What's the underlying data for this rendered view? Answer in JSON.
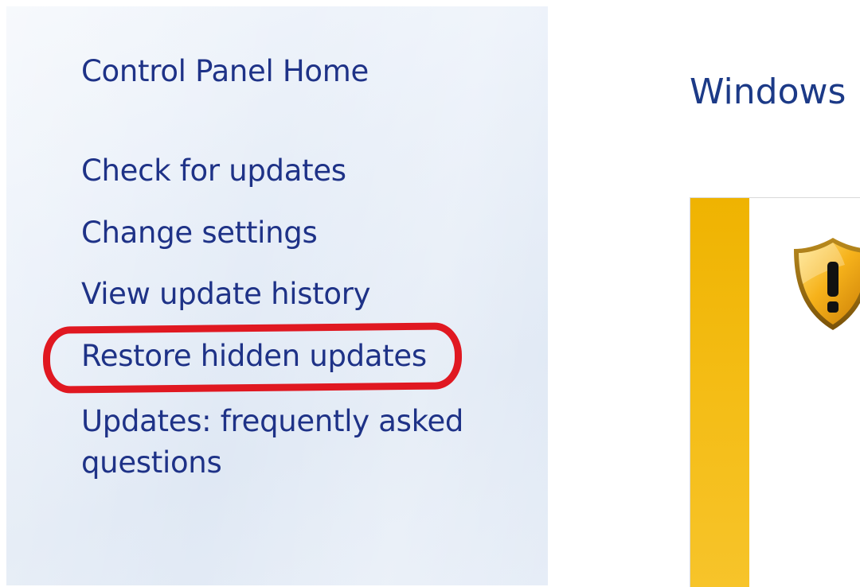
{
  "sidebar": {
    "home_label": "Control Panel Home",
    "items": [
      {
        "label": "Check for updates"
      },
      {
        "label": "Change settings"
      },
      {
        "label": "View update history"
      },
      {
        "label": "Restore hidden updates"
      },
      {
        "label": "Updates: frequently asked questions"
      }
    ]
  },
  "main": {
    "title": "Windows",
    "status_icon": "warning-shield-icon"
  },
  "colors": {
    "link": "#1e3287",
    "title": "#1c3a87",
    "highlight": "#e01821",
    "warning_bar": "#f4bd16"
  }
}
